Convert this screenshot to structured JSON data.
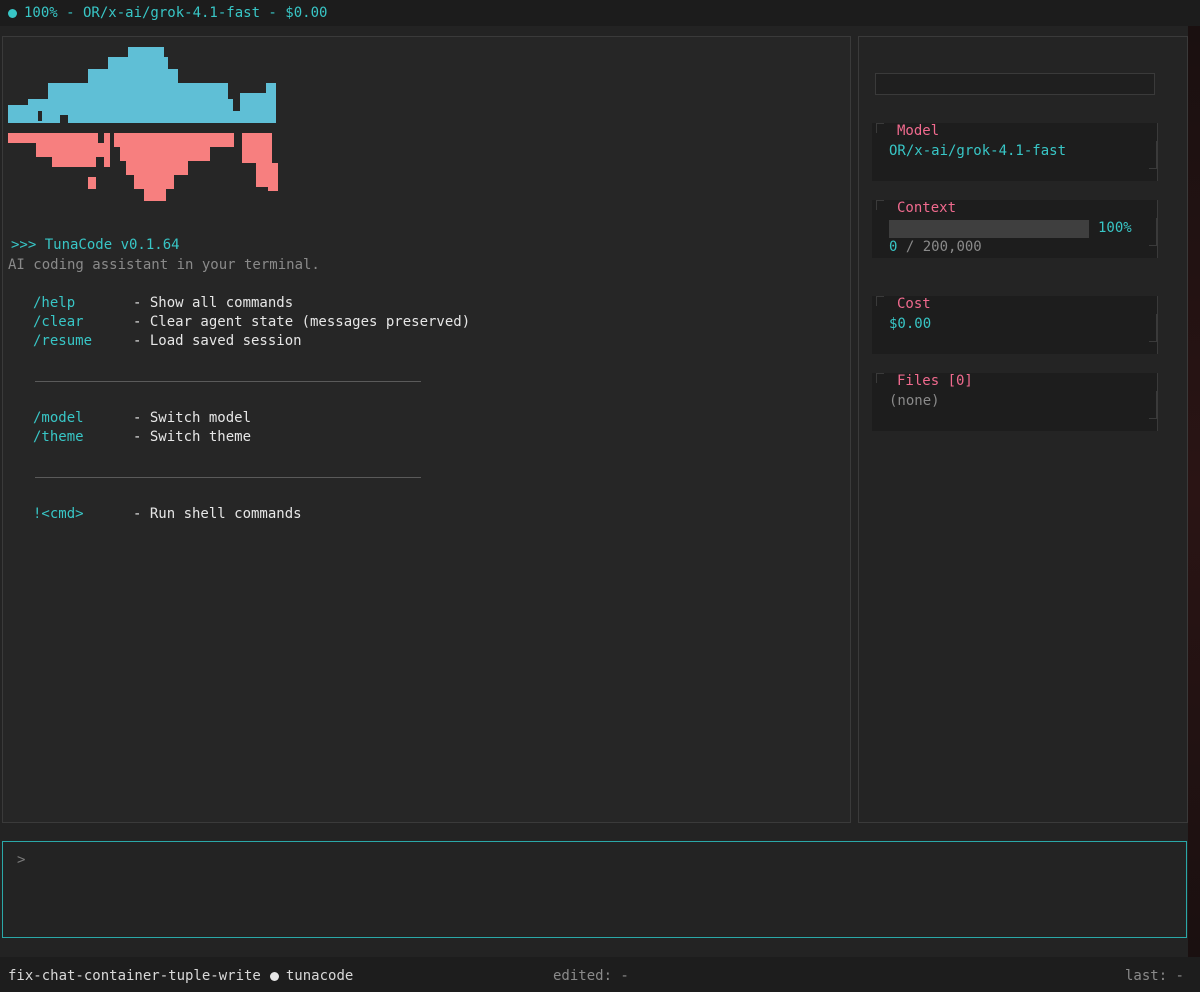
{
  "topbar": {
    "status": "100% - OR/x-ai/grok-4.1-fast - $0.00",
    "dot_color": "#38c6c6"
  },
  "welcome": {
    "prompt": ">>> TunaCode v0.1.64",
    "tagline": "AI coding assistant in your terminal."
  },
  "commands": [
    {
      "cmd": "/help",
      "desc": "- Show all commands"
    },
    {
      "cmd": "/clear",
      "desc": "- Clear agent state (messages preserved)"
    },
    {
      "cmd": "/resume",
      "desc": "- Load saved session"
    },
    {
      "cmd": "/model",
      "desc": "- Switch model"
    },
    {
      "cmd": "/theme",
      "desc": "- Switch theme"
    },
    {
      "cmd": "!<cmd>",
      "desc": "- Run shell commands"
    }
  ],
  "sidebar": {
    "model": {
      "title": "Model",
      "value": "OR/x-ai/grok-4.1-fast"
    },
    "context": {
      "title": "Context",
      "percent_label": "100%",
      "usage": "0 / 200,000",
      "fill_fraction": 0.0
    },
    "cost": {
      "title": "Cost",
      "value": "$0.00"
    },
    "files": {
      "title": "Files [0]",
      "value": "(none)"
    }
  },
  "input": {
    "prompt": ">"
  },
  "statusbar": {
    "branch": "fix-chat-container-tuple-write",
    "project": "tunacode",
    "edited": "edited: -",
    "last": "last: -"
  },
  "colors": {
    "accent": "#38c6c6",
    "pink": "#f06a8e",
    "logo_top": "#5fbfd6",
    "logo_bottom": "#f77f7f"
  }
}
